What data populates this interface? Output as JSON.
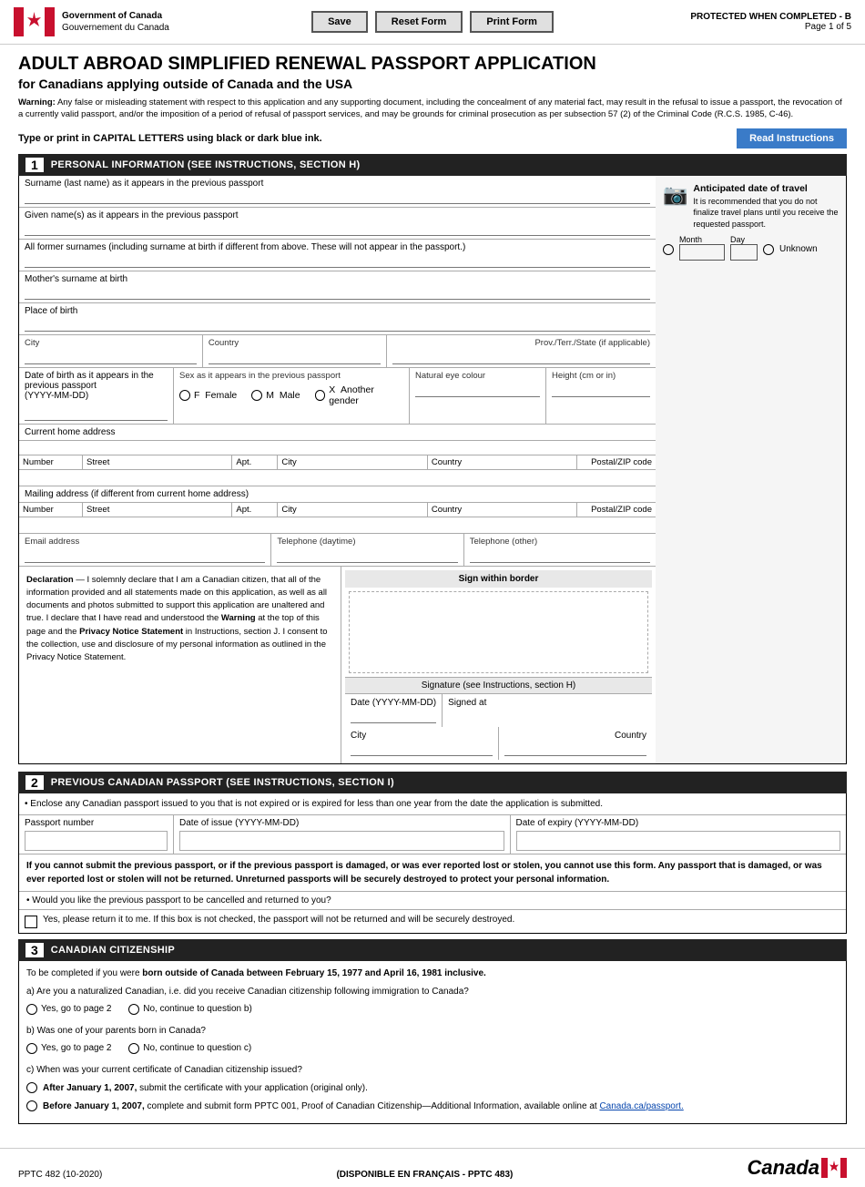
{
  "header": {
    "gov_en": "Government of Canada",
    "gov_fr": "Gouvernement du Canada",
    "protected": "PROTECTED WHEN COMPLETED - B",
    "page": "Page 1 of 5",
    "buttons": {
      "save": "Save",
      "reset": "Reset Form",
      "print": "Print Form"
    }
  },
  "form": {
    "title": "ADULT ABROAD SIMPLIFIED RENEWAL PASSPORT APPLICATION",
    "subtitle": "for Canadians applying outside of Canada and the USA",
    "warning_label": "Warning:",
    "warning_text": "Any false or misleading statement with respect to this application and any supporting document, including the concealment of any material fact, may result in the refusal to issue a passport, the revocation of a currently valid passport, and/or the imposition of a period of refusal of passport services, and may be grounds for criminal prosecution as per subsection 57 (2) of the Criminal Code (R.C.S. 1985, C-46).",
    "type_print_label": "Type or print in CAPITAL LETTERS using black or dark blue ink.",
    "read_instructions": "Read Instructions"
  },
  "section1": {
    "number": "1",
    "title": "PERSONAL INFORMATION (SEE INSTRUCTIONS, SECTION H)",
    "fields": {
      "surname_label": "Surname (last name) as it appears in the previous passport",
      "given_names_label": "Given name(s) as it appears in the previous passport",
      "all_former_surnames_label": "All former surnames (including surname at birth if different from above. These will not appear in the passport.)",
      "mothers_surname_label": "Mother's surname at birth",
      "place_of_birth_label": "Place of birth",
      "city_label": "City",
      "country_label": "Country",
      "prov_label": "Prov./Terr./State (if applicable)",
      "dob_label": "Date of birth as it appears in the previous passport",
      "dob_format": "(YYYY-MM-DD)",
      "sex_label": "Sex as it appears in the previous passport",
      "sex_options": [
        "F  Female",
        "M  Male",
        "X  Another gender"
      ],
      "eye_colour_label": "Natural eye colour",
      "height_label": "Height (cm or in)",
      "current_home_address_label": "Current home address",
      "number_label": "Number",
      "street_label": "Street",
      "apt_label": "Apt.",
      "city2_label": "City",
      "country2_label": "Country",
      "postal_label": "Postal/ZIP code",
      "mailing_address_label": "Mailing address (if different from current home address)",
      "email_label": "Email address",
      "tel_day_label": "Telephone (daytime)",
      "tel_other_label": "Telephone (other)"
    },
    "anticipated_travel": {
      "title": "Anticipated date of travel",
      "subtitle": "It is recommended that you do not finalize travel plans until you receive the requested passport.",
      "month_label": "Month",
      "day_label": "Day",
      "unknown_label": "Unknown"
    },
    "declaration": {
      "title": "Declaration",
      "dash": "—",
      "text": "I solemnly declare that I am a Canadian citizen, that all of the information provided and all statements made on this application, as well as all documents and photos submitted to support this application are unaltered and true. I declare that I have read and understood the ",
      "warning_word": "Warning",
      "text2": " at the top of this page and the ",
      "privacy_word": "Privacy Notice Statement",
      "text3": " in Instructions, section J. I consent to the collection, use and disclosure of my personal information as outlined in the Privacy Notice Statement.",
      "sign_within_border": "Sign within border",
      "signature_instruction": "Signature (see Instructions, section H)",
      "date_label": "Date (YYYY-MM-DD)",
      "signed_at_label": "Signed at",
      "city_label": "City",
      "country_label": "Country"
    }
  },
  "section2": {
    "number": "2",
    "title": "PREVIOUS CANADIAN PASSPORT (SEE INSTRUCTIONS, SECTION I)",
    "bullet1": "Enclose any Canadian passport issued to you that is not expired or is expired for less than one year from the date the application is submitted.",
    "passport_number_label": "Passport number",
    "date_of_issue_label": "Date of issue (YYYY-MM-DD)",
    "date_of_expiry_label": "Date of expiry (YYYY-MM-DD)",
    "info_text": "If you cannot submit the previous passport, or if the previous passport is damaged, or was ever reported lost or stolen, you cannot use this form. Any passport that is damaged, or was ever reported lost or stolen will not be returned. Unreturned passports will be securely destroyed to protect your personal information.",
    "return_question": "Would you like the previous passport to be cancelled and returned to you?",
    "return_checkbox_label": "Yes, please return it to me. If this box is not checked, the passport will not be returned and will be securely destroyed."
  },
  "section3": {
    "number": "3",
    "title": "CANADIAN CITIZENSHIP",
    "intro": "To be completed if you were ",
    "intro_bold": "born outside of Canada between February 15, 1977 and April 16, 1981 inclusive.",
    "question_a": "a)  Are you a naturalized Canadian, i.e. did you receive Canadian citizenship following immigration to Canada?",
    "qa_yes": "Yes, go to page 2",
    "qa_no": "No, continue to question b)",
    "question_b": "b)  Was one of your parents born in Canada?",
    "qb_yes": "Yes, go to page 2",
    "qb_no": "No, continue to question c)",
    "question_c": "c)  When was your current certificate of Canadian citizenship issued?",
    "qc_after_label": "After January 1, 2007,",
    "qc_after_text": "submit the certificate with your application (original only).",
    "qc_before_label": "Before January 1, 2007,",
    "qc_before_text": "complete and submit form PPTC 001, Proof of Canadian Citizenship—Additional Information, available online at ",
    "qc_link": "Canada.ca/passport."
  },
  "footer": {
    "form_number": "PPTC 482 (10-2020)",
    "french": "(DISPONIBLE EN FRANÇAIS - PPTC 483)",
    "canada_wordmark": "Canada"
  }
}
